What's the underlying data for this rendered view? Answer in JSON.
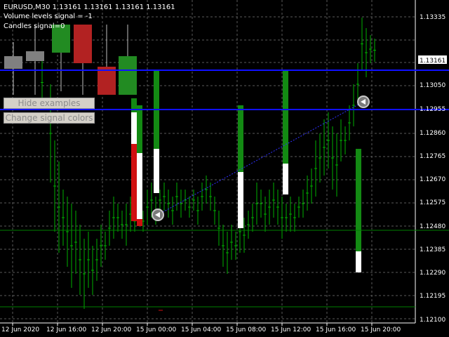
{
  "header": {
    "symbol_line": "EURUSD,M30  1.13161 1.13161 1.13161 1.13161",
    "volume_signal": "Volume levels signal = -1",
    "candles_signal": "Candles signal=0"
  },
  "buttons": {
    "hide_examples": "Hide examples",
    "change_colors": "Change signal colors"
  },
  "price_axis": {
    "labels": [
      "1.13335",
      "1.13161",
      "1.13050",
      "1.12955",
      "1.12860",
      "1.12765",
      "1.12670",
      "1.12575",
      "1.12480",
      "1.12385",
      "1.12290",
      "1.12195",
      "1.12100"
    ],
    "current_price": "1.13161"
  },
  "time_axis": {
    "labels": [
      "12 Jun 2020",
      "12 Jun 16:00",
      "12 Jun 20:00",
      "15 Jun 00:00",
      "15 Jun 04:00",
      "15 Jun 08:00",
      "15 Jun 12:00",
      "15 Jun 16:00",
      "15 Jun 20:00"
    ]
  },
  "colors": {
    "background": "#000000",
    "grid": "#5a5a5a",
    "candle": "#00b000",
    "level_line": "#1010ff",
    "support_line": "#008000",
    "bull": "#138a13",
    "bear": "#d01010",
    "neutral": "#ffffff",
    "legend_gray": "#808080",
    "legend_green": "#228b22",
    "legend_red": "#b22222"
  },
  "icons": {
    "arrow_marker": "arrow-marker-icon"
  }
}
